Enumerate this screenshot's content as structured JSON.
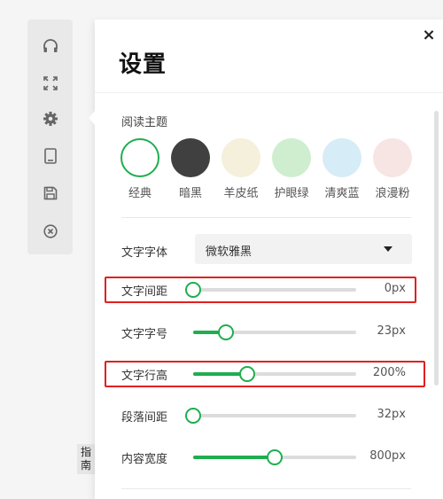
{
  "toolbar": {
    "icons": [
      "headphones-icon",
      "fullscreen-icon",
      "gear-icon",
      "tablet-icon",
      "save-icon",
      "close-circle-icon"
    ]
  },
  "guide_label": [
    "指",
    "南"
  ],
  "panel": {
    "title": "设置",
    "close_label": "×"
  },
  "theme": {
    "label": "阅读主题",
    "options": [
      {
        "label": "经典",
        "color": "#ffffff",
        "selected": true
      },
      {
        "label": "暗黑",
        "color": "#404040",
        "selected": false
      },
      {
        "label": "羊皮纸",
        "color": "#f5f0dc",
        "selected": false
      },
      {
        "label": "护眼绿",
        "color": "#cfeed0",
        "selected": false
      },
      {
        "label": "清爽蓝",
        "color": "#d6ecf7",
        "selected": false
      },
      {
        "label": "浪漫粉",
        "color": "#f6e5e3",
        "selected": false
      }
    ]
  },
  "font": {
    "label": "文字字体",
    "value": "微软雅黑"
  },
  "sliders": [
    {
      "label": "文字间距",
      "value": "0px",
      "fraction": 0.0,
      "highlighted": true
    },
    {
      "label": "文字字号",
      "value": "23px",
      "fraction": 0.2,
      "highlighted": false
    },
    {
      "label": "文字行高",
      "value": "200%",
      "fraction": 0.33,
      "highlighted": true
    },
    {
      "label": "段落间距",
      "value": "32px",
      "fraction": 0.0,
      "highlighted": false
    },
    {
      "label": "内容宽度",
      "value": "800px",
      "fraction": 0.5,
      "highlighted": false
    }
  ],
  "colors": {
    "accent": "#1fae4f",
    "highlight": "#e02020"
  }
}
